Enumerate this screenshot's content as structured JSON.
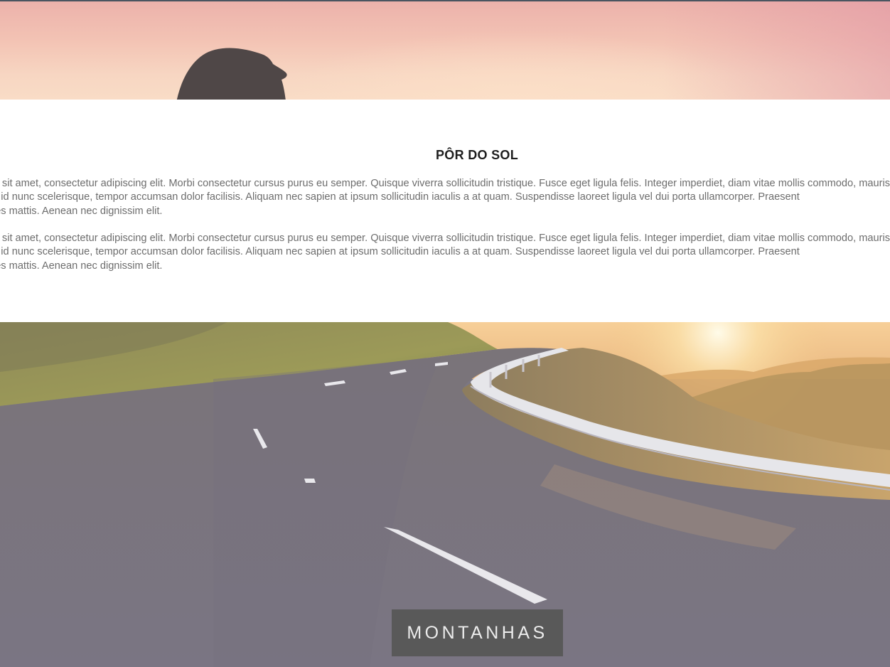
{
  "section": {
    "title": "PÔR DO SOL",
    "paragraphs": [
      {
        "lines": [
          "Lorem ipsum dolor sit amet, consectetur adipiscing elit. Morbi consectetur cursus purus eu semper. Quisque viverra sollicitudin tristique. Fusce eget ligula felis. Integer imperdiet, diam vitae mollis commodo, mauris",
          "ex commodo diam id nunc scelerisque, tempor accumsan dolor facilisis. Aliquam nec sapien at ipsum sollicitudin iaculis a at quam. Suspendisse laoreet ligula vel dui porta ullamcorper. Praesent",
          "ursus quam sodales mattis. Aenean nec dignissim elit."
        ]
      },
      {
        "lines": [
          "Lorem ipsum dolor sit amet, consectetur adipiscing elit. Morbi consectetur cursus purus eu semper. Quisque viverra sollicitudin tristique. Fusce eget ligula felis. Integer imperdiet, diam vitae mollis commodo, mauris",
          "ex commodo diam id nunc scelerisque, tempor accumsan dolor facilisis. Aliquam nec sapien at ipsum sollicitudin iaculis a at quam. Suspendisse laoreet ligula vel dui porta ullamcorper. Praesent",
          "ursus quam sodales mattis. Aenean nec dignissim elit."
        ]
      }
    ]
  },
  "hero_bottom": {
    "badge_label": "MONTANHAS"
  },
  "colors": {
    "title": "#1e1e1e",
    "body_text": "#6d6d6d",
    "badge_bg": "#595959",
    "badge_text": "#ececec"
  }
}
